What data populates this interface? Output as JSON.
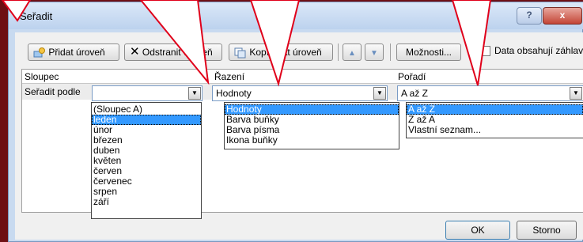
{
  "window": {
    "title": "Seřadit",
    "help_label": "?",
    "close_label": "x"
  },
  "toolbar": {
    "add_level": "Přidat úroveň",
    "delete_level": "Odstranit úroveň",
    "copy_level": "Kopírovat úroveň",
    "options": "Možnosti...",
    "data_has_headers": "Data obsahují záhlaví"
  },
  "grid": {
    "headers": {
      "column": "Sloupec",
      "sort_on": "Řazení",
      "order": "Pořadí"
    },
    "row": {
      "label": "Seřadit podle",
      "column_value": "",
      "sort_on_value": "Hodnoty",
      "order_value": "A až Z"
    }
  },
  "column_dropdown": {
    "items": [
      "(Sloupec A)",
      "leden",
      "únor",
      "březen",
      "duben",
      "květen",
      "červen",
      "červenec",
      "srpen",
      "září"
    ],
    "selected_index": 1
  },
  "sort_on_dropdown": {
    "items": [
      "Hodnoty",
      "Barva buňky",
      "Barva písma",
      "Ikona buňky"
    ],
    "selected_index": 0
  },
  "order_dropdown": {
    "items": [
      "A až Z",
      "Z až A",
      "Vlastní seznam..."
    ],
    "selected_index": 0
  },
  "buttons": {
    "ok": "OK",
    "cancel": "Storno"
  },
  "colors": {
    "background": "#6e0f13",
    "selection": "#3399ff",
    "callout_outline": "#e0001a"
  }
}
